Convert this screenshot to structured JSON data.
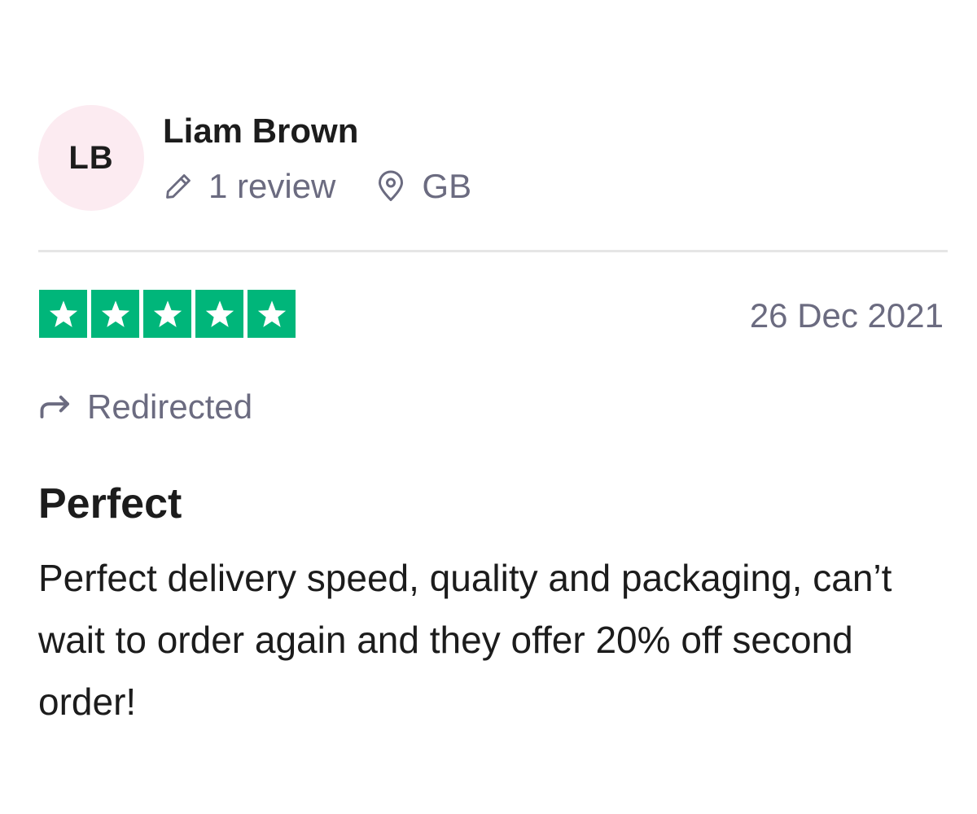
{
  "reviewer": {
    "initials": "LB",
    "name": "Liam Brown",
    "review_count": "1 review",
    "country": "GB",
    "avatar_color": "#fcebf1"
  },
  "rating": {
    "stars": 5,
    "max_stars": 5,
    "star_color": "#00b67a"
  },
  "review": {
    "date": "26 Dec 2021",
    "status": "Redirected",
    "title": "Perfect",
    "body": "Perfect delivery speed, quality and packaging, can’t wait to order again and they offer 20% off second order!"
  },
  "icons": {
    "review_count": "pencil-icon",
    "country": "location-pin-icon",
    "status": "redirect-arrow-icon",
    "star": "star-icon"
  }
}
